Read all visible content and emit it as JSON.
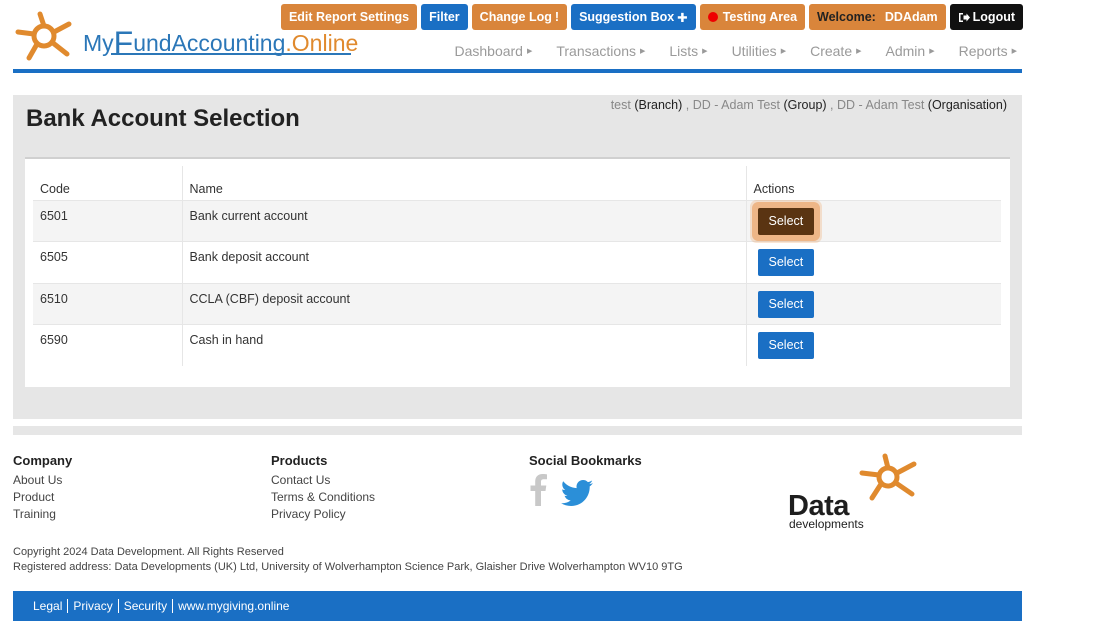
{
  "brand": {
    "logo_my": "My",
    "logo_f": "F",
    "logo_rest": "und",
    "logo_accounting": "Accounting",
    "logo_online": ".Online",
    "orange": "#e08a2e",
    "blue": "#2b77b8"
  },
  "topbar": {
    "edit_report": "Edit Report Settings",
    "filter": "Filter",
    "change_log": "Change Log",
    "change_log_icon": "!",
    "suggestion_box": "Suggestion Box",
    "suggestion_icon": "✚",
    "testing_area": "Testing Area",
    "welcome_label": "Welcome:",
    "username": "DDAdam",
    "logout": "Logout"
  },
  "nav": {
    "items": [
      "Dashboard",
      "Transactions",
      "Lists",
      "Utilities",
      "Create",
      "Admin",
      "Reports"
    ]
  },
  "page": {
    "title": "Bank Account Selection",
    "context": {
      "branch_name": "test",
      "branch_label": "(Branch)",
      "group_name": "DD - Adam Test",
      "group_label": "(Group)",
      "org_name": "DD - Adam Test",
      "org_label": "(Organisation)"
    }
  },
  "table": {
    "headers": [
      "Code",
      "Name",
      "Actions"
    ],
    "select_label": "Select",
    "rows": [
      {
        "code": "6501",
        "name": "Bank current account"
      },
      {
        "code": "6505",
        "name": "Bank deposit account"
      },
      {
        "code": "6510",
        "name": "CCLA (CBF) deposit account"
      },
      {
        "code": "6590",
        "name": "Cash in hand"
      }
    ]
  },
  "footer": {
    "company": {
      "heading": "Company",
      "links": [
        "About Us",
        "Product",
        "Training"
      ]
    },
    "products": {
      "heading": "Products",
      "links": [
        "Contact Us",
        "Terms & Conditions",
        "Privacy Policy"
      ]
    },
    "social": {
      "heading": "Social Bookmarks",
      "icons": [
        "facebook-icon",
        "twitter-icon"
      ]
    },
    "brand_word": "Data",
    "brand_sub": "developments",
    "copyright": "Copyright 2024 Data Development. All Rights Reserved",
    "address": "Registered address: Data Developments (UK) Ltd, University of Wolverhampton Science Park, Glaisher Drive Wolverhampton WV10 9TG",
    "bottom_links": [
      "Legal",
      "Privacy",
      "Security",
      "www.mygiving.online"
    ]
  }
}
